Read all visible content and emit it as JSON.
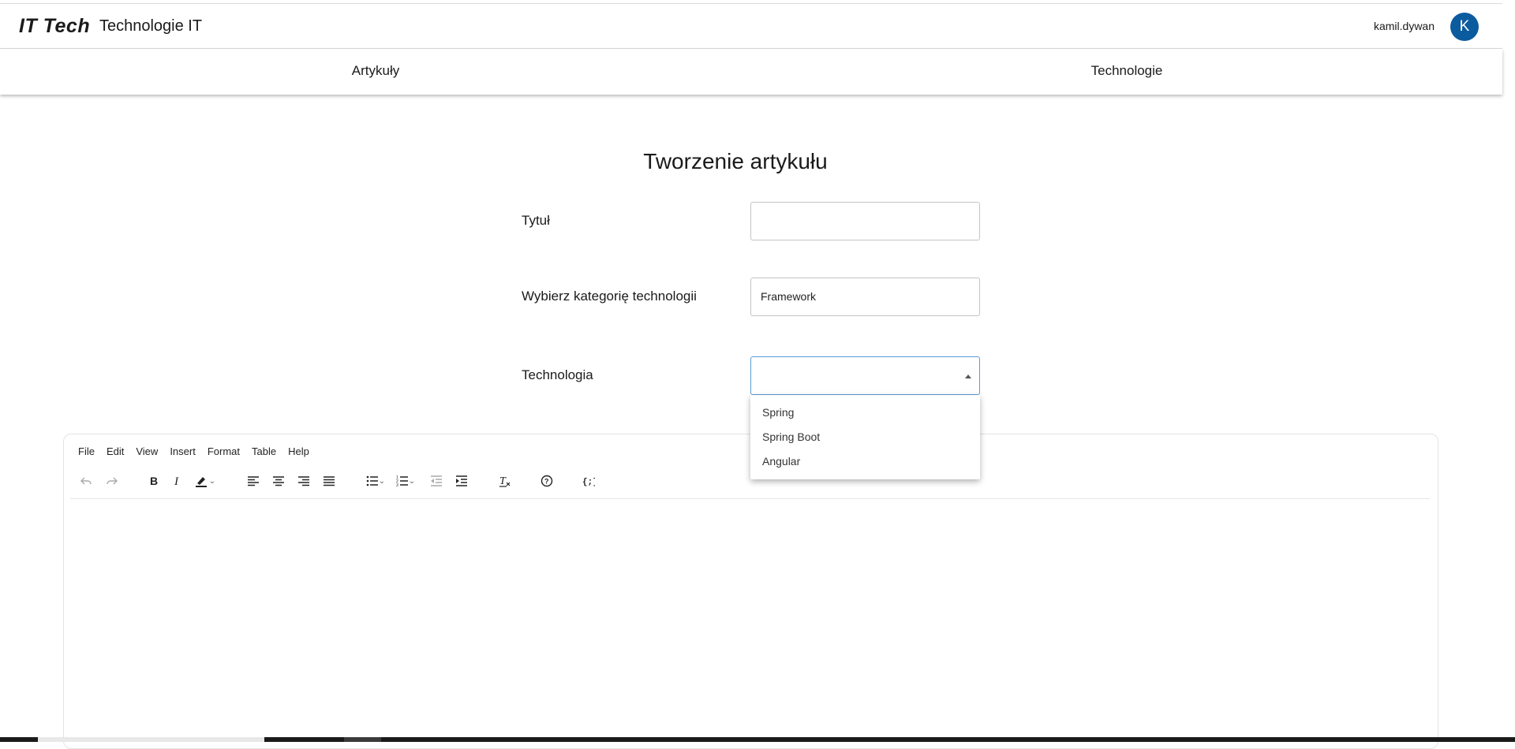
{
  "header": {
    "brand": "IT Tech",
    "title": "Technologie IT",
    "username": "kamil.dywan",
    "avatar_initial": "K",
    "avatar_color": "#0b5b9f"
  },
  "nav": {
    "items": [
      {
        "label": "Artykuły"
      },
      {
        "label": "Technologie"
      }
    ]
  },
  "form": {
    "page_title": "Tworzenie artykułu",
    "title_label": "Tytuł",
    "title_value": "",
    "category_label": "Wybierz kategorię technologii",
    "category_value": "Framework",
    "technology_label": "Technologia",
    "technology_value": "",
    "technology_options": [
      "Spring",
      "Spring Boot",
      "Angular"
    ]
  },
  "editor": {
    "menu": [
      "File",
      "Edit",
      "View",
      "Insert",
      "Format",
      "Table",
      "Help"
    ],
    "toolbar_icons": [
      "undo-icon",
      "redo-icon",
      "bold-icon",
      "italic-icon",
      "highlight-icon",
      "align-left-icon",
      "align-center-icon",
      "align-right-icon",
      "align-justify-icon",
      "bullet-list-icon",
      "numbered-list-icon",
      "outdent-icon",
      "indent-icon",
      "clear-formatting-icon",
      "help-icon",
      "code-sample-icon"
    ],
    "content": ""
  }
}
